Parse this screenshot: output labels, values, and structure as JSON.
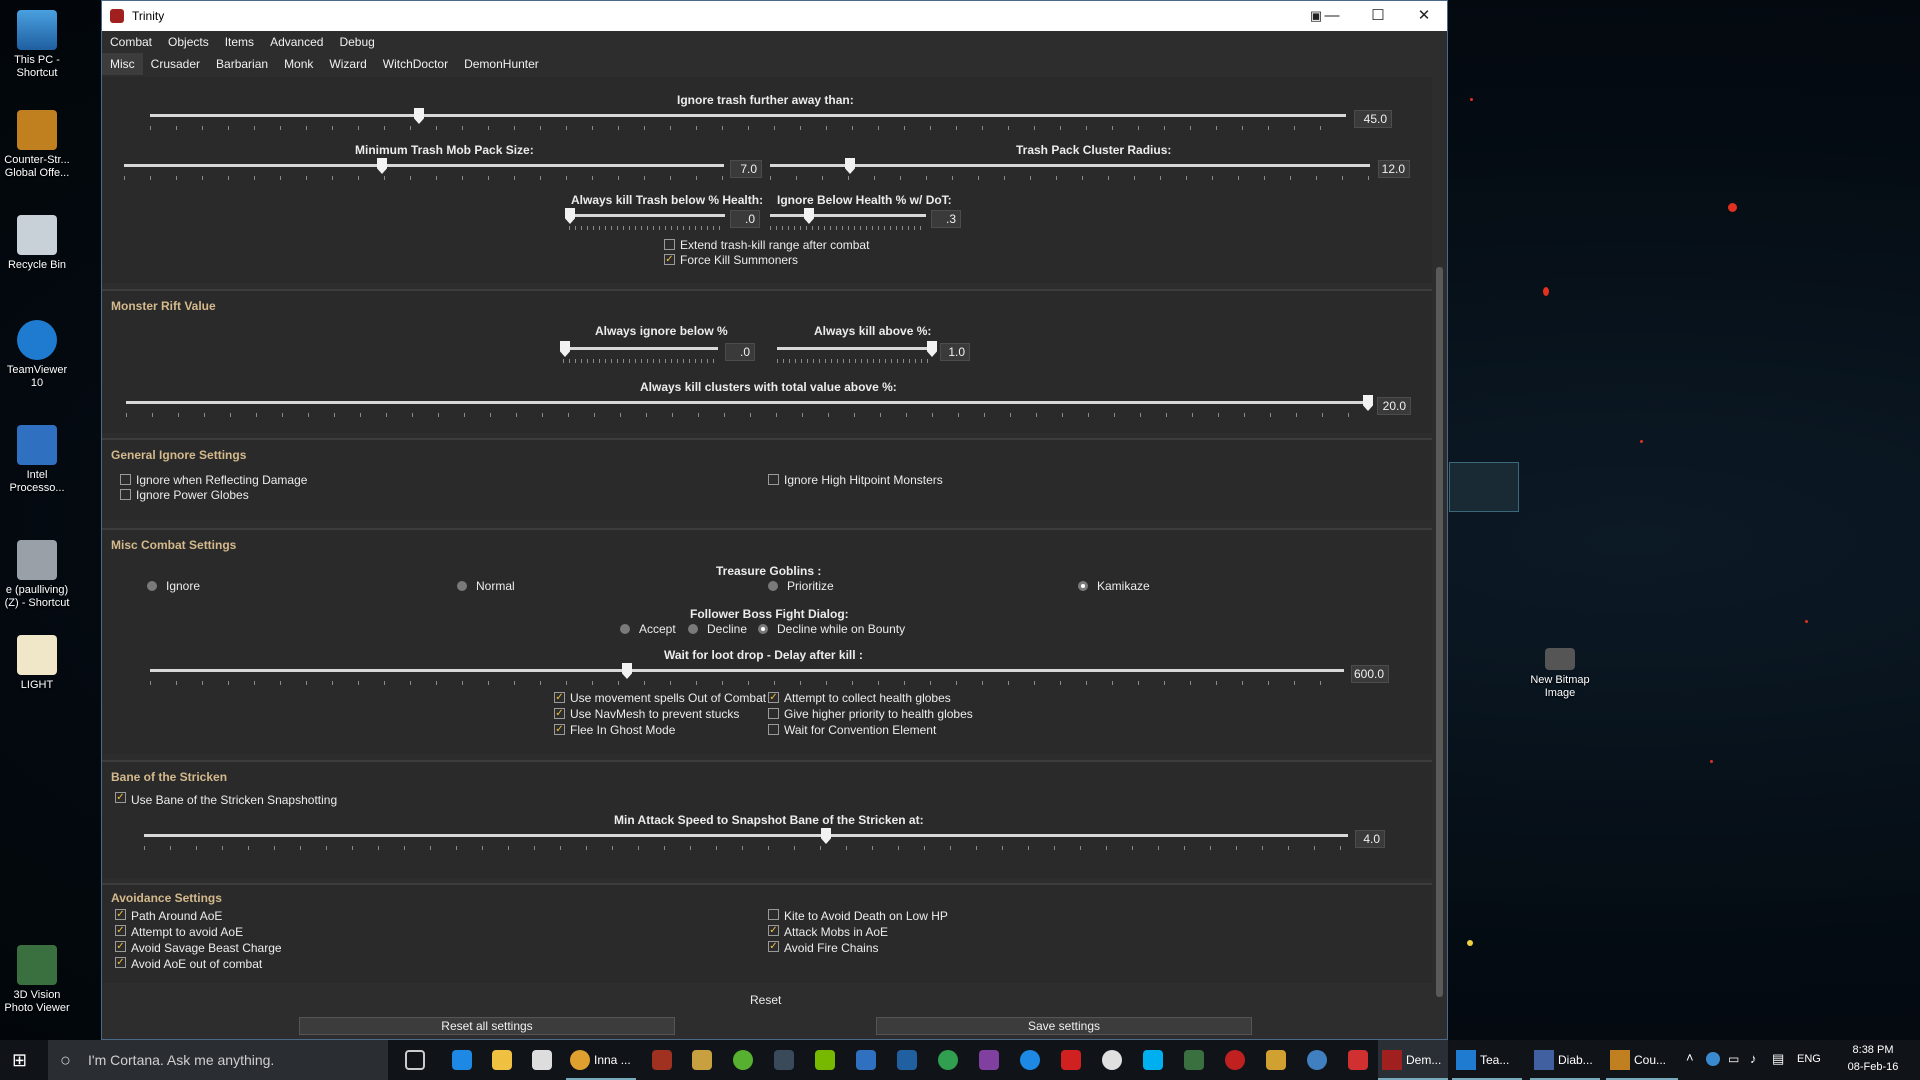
{
  "desktop": {
    "icons": [
      {
        "label": "This PC - Shortcut"
      },
      {
        "label": "Counter-Str... Global Offe..."
      },
      {
        "label": "Recycle Bin"
      },
      {
        "label": "TeamViewer 10"
      },
      {
        "label": "Intel Processo..."
      },
      {
        "label": "e (paulliving) (Z) - Shortcut"
      },
      {
        "label": "LIGHT"
      },
      {
        "label": "3D Vision Photo Viewer"
      }
    ],
    "right_icon": {
      "label": "New Bitmap Image"
    }
  },
  "window": {
    "title": "Trinity",
    "menu": [
      "Combat",
      "Objects",
      "Items",
      "Advanced",
      "Debug"
    ],
    "tabs": [
      "Misc",
      "Crusader",
      "Barbarian",
      "Monk",
      "Wizard",
      "WitchDoctor",
      "DemonHunter"
    ],
    "trash": {
      "ignore_further_label": "Ignore trash further away than:",
      "ignore_further_value": "45.0",
      "min_pack_label": "Minimum Trash Mob Pack Size:",
      "min_pack_value": "7.0",
      "cluster_radius_label": "Trash Pack Cluster Radius:",
      "cluster_radius_value": "12.0",
      "kill_below_label": "Always kill Trash below % Health:",
      "kill_below_value": ".0",
      "ignore_dot_label": "Ignore Below Health % w/ DoT:",
      "ignore_dot_value": ".3",
      "extend_label": "Extend trash-kill range after combat",
      "force_kill_label": "Force Kill Summoners"
    },
    "rift": {
      "title": "Monster Rift Value",
      "ignore_below_label": "Always ignore below %",
      "ignore_below_value": ".0",
      "kill_above_label": "Always kill above %:",
      "kill_above_value": "1.0",
      "clusters_label": "Always kill clusters with total value above %:",
      "clusters_value": "20.0"
    },
    "ignore": {
      "title": "General Ignore Settings",
      "reflecting": "Ignore when Reflecting Damage",
      "power_globes": "Ignore Power Globes",
      "high_hp": "Ignore High Hitpoint Monsters"
    },
    "misc": {
      "title": "Misc Combat Settings",
      "goblins_label": "Treasure Goblins :",
      "goblin_options": [
        "Ignore",
        "Normal",
        "Prioritize",
        "Kamikaze"
      ],
      "follower_label": "Follower Boss Fight Dialog:",
      "follower_options": [
        "Accept",
        "Decline",
        "Decline while on Bounty"
      ],
      "loot_label": "Wait for loot drop - Delay after kill :",
      "loot_value": "600.0",
      "movement_spells": "Use movement spells Out of Combat",
      "navmesh": "Use NavMesh to prevent stucks",
      "ghost": "Flee In Ghost Mode",
      "collect_globes": "Attempt to collect health globes",
      "priority_globes": "Give higher priority to health globes",
      "convention": "Wait for Convention Element"
    },
    "bane": {
      "title": "Bane of the Stricken",
      "snapshot": "Use Bane of the Stricken Snapshotting",
      "speed_label": "Min Attack Speed to Snapshot Bane of the Stricken at:",
      "speed_value": "4.0"
    },
    "avoid": {
      "title": "Avoidance Settings",
      "path_around": "Path Around AoE",
      "attempt_avoid": "Attempt to avoid AoE",
      "savage": "Avoid Savage Beast Charge",
      "out_of_combat": "Avoid AoE out of combat",
      "kite": "Kite to Avoid Death on Low HP",
      "attack_mobs": "Attack Mobs in AoE",
      "fire_chains": "Avoid Fire Chains"
    },
    "reset": "Reset",
    "reset_all": "Reset all settings",
    "save": "Save settings"
  },
  "taskbar": {
    "search_placeholder": "I'm Cortana. Ask me anything.",
    "tasks": [
      "Inna ...",
      "Dem...",
      "Tea...",
      "Diab...",
      "Cou..."
    ],
    "lang": "ENG",
    "time": "8:38 PM",
    "date": "08-Feb-16"
  }
}
